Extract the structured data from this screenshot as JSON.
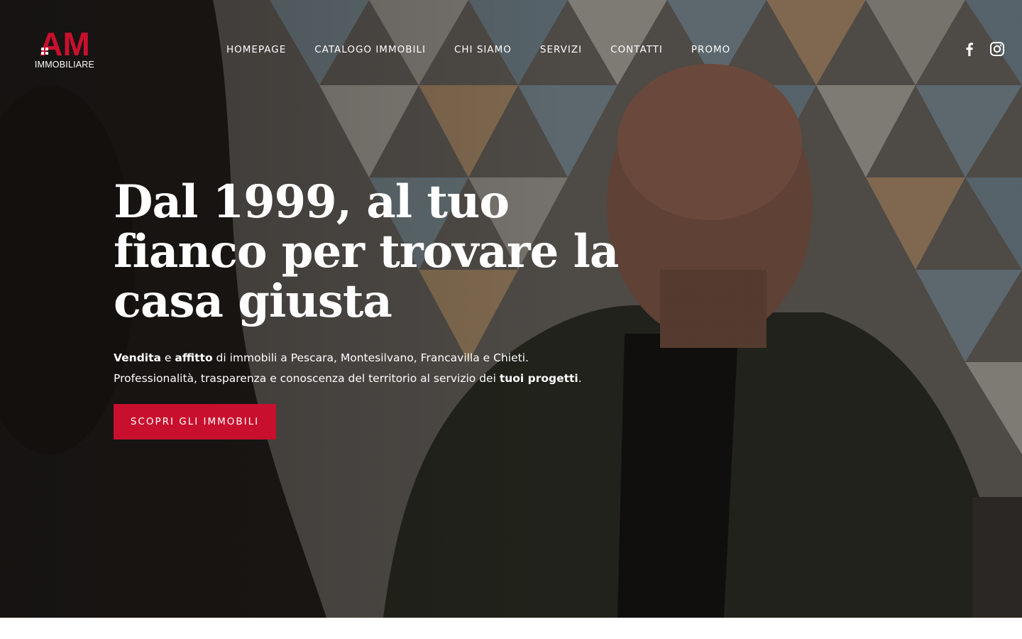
{
  "brand": {
    "logo_letters": "AM",
    "logo_word": "IMMOBILIARE",
    "accent_color": "#c8102e"
  },
  "nav": {
    "items": [
      "HOMEPAGE",
      "CATALOGO IMMOBILI",
      "CHI SIAMO",
      "SERVIZI",
      "CONTATTI",
      "PROMO"
    ]
  },
  "social": {
    "icons": [
      "facebook-icon",
      "instagram-icon"
    ]
  },
  "hero": {
    "headline": "Dal 1999, al tuo fianco per trovare la casa giusta",
    "line1": {
      "b1": "Vendita",
      "t1": " e ",
      "b2": "affitto",
      "t2": " di immobili a Pescara, Montesilvano, Francavilla e Chieti."
    },
    "line2": {
      "t1": "Professionalità, trasparenza e conoscenza del territorio al servizio dei ",
      "b1": "tuoi progetti",
      "t2": "."
    },
    "cta_label": "SCOPRI GLI IMMOBILI"
  }
}
